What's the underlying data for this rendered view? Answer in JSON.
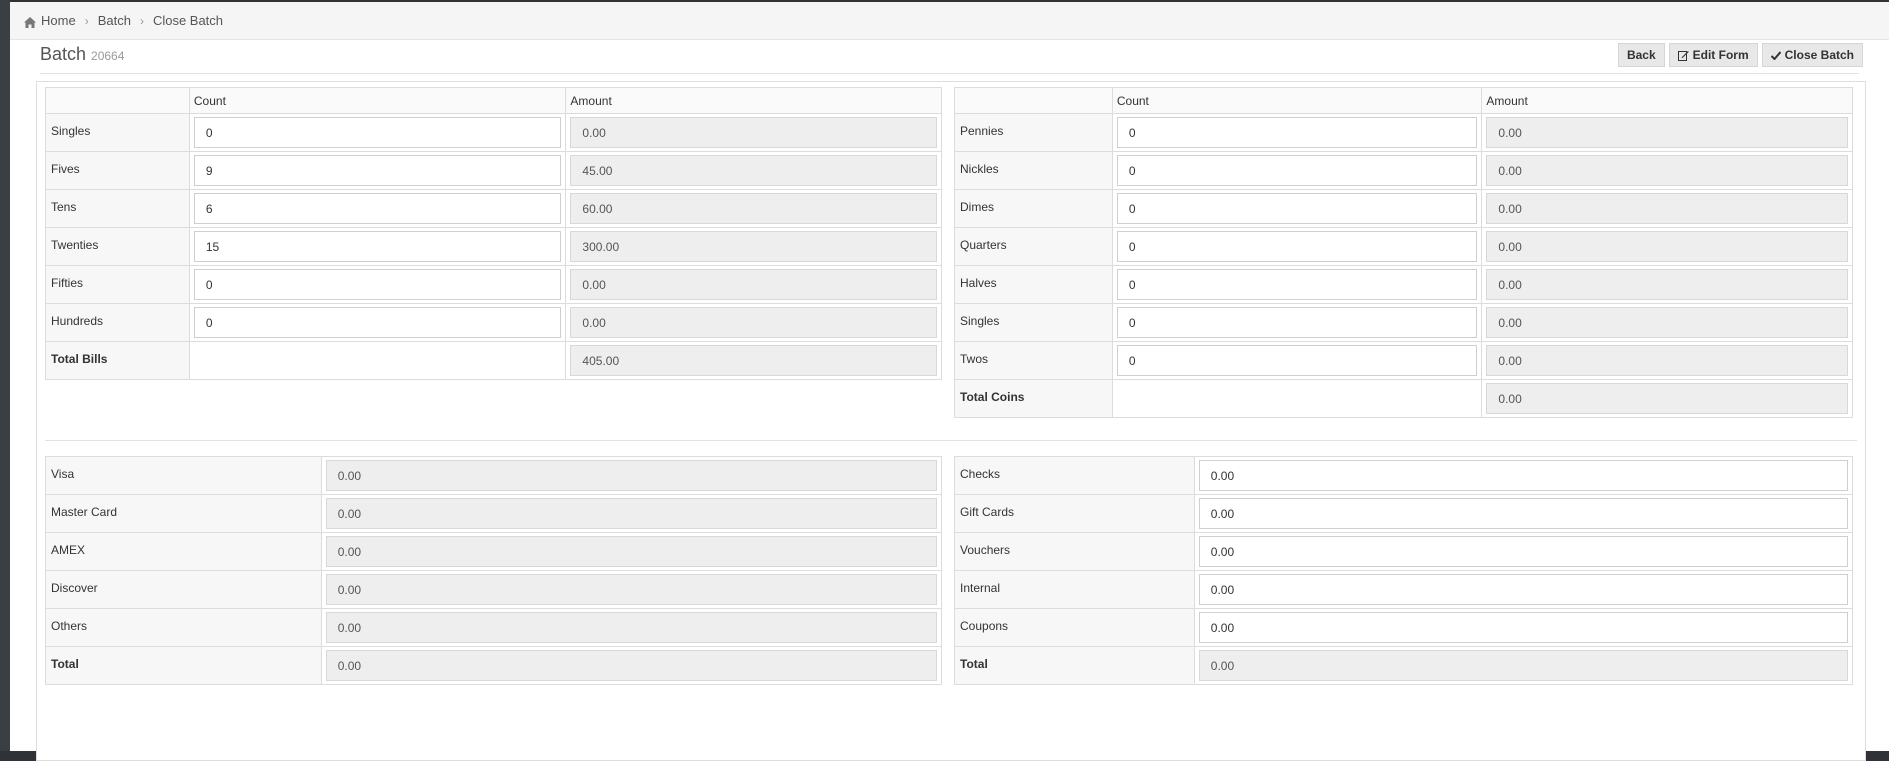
{
  "breadcrumb": {
    "home": "Home",
    "batch": "Batch",
    "current": "Close Batch"
  },
  "header": {
    "title": "Batch",
    "batch_id": "20664"
  },
  "actions": {
    "back": "Back",
    "edit_form": "Edit Form",
    "close_batch": "Close Batch"
  },
  "bills": {
    "col_count": "Count",
    "col_amount": "Amount",
    "rows": [
      {
        "label": "Singles",
        "count": "0",
        "amount": "0.00"
      },
      {
        "label": "Fives",
        "count": "9",
        "amount": "45.00"
      },
      {
        "label": "Tens",
        "count": "6",
        "amount": "60.00"
      },
      {
        "label": "Twenties",
        "count": "15",
        "amount": "300.00"
      },
      {
        "label": "Fifties",
        "count": "0",
        "amount": "0.00"
      },
      {
        "label": "Hundreds",
        "count": "0",
        "amount": "0.00"
      }
    ],
    "total_label": "Total Bills",
    "total_amount": "405.00"
  },
  "coins": {
    "col_count": "Count",
    "col_amount": "Amount",
    "rows": [
      {
        "label": "Pennies",
        "count": "0",
        "amount": "0.00"
      },
      {
        "label": "Nickles",
        "count": "0",
        "amount": "0.00"
      },
      {
        "label": "Dimes",
        "count": "0",
        "amount": "0.00"
      },
      {
        "label": "Quarters",
        "count": "0",
        "amount": "0.00"
      },
      {
        "label": "Halves",
        "count": "0",
        "amount": "0.00"
      },
      {
        "label": "Singles",
        "count": "0",
        "amount": "0.00"
      },
      {
        "label": "Twos",
        "count": "0",
        "amount": "0.00"
      }
    ],
    "total_label": "Total Coins",
    "total_amount": "0.00"
  },
  "cards": {
    "rows": [
      {
        "label": "Visa",
        "amount": "0.00"
      },
      {
        "label": "Master Card",
        "amount": "0.00"
      },
      {
        "label": "AMEX",
        "amount": "0.00"
      },
      {
        "label": "Discover",
        "amount": "0.00"
      },
      {
        "label": "Others",
        "amount": "0.00"
      }
    ],
    "total_label": "Total",
    "total_amount": "0.00"
  },
  "other_tenders": {
    "rows": [
      {
        "label": "Checks",
        "amount": "0.00"
      },
      {
        "label": "Gift Cards",
        "amount": "0.00"
      },
      {
        "label": "Vouchers",
        "amount": "0.00"
      },
      {
        "label": "Internal",
        "amount": "0.00"
      },
      {
        "label": "Coupons",
        "amount": "0.00"
      }
    ],
    "total_label": "Total",
    "total_amount": "0.00"
  }
}
